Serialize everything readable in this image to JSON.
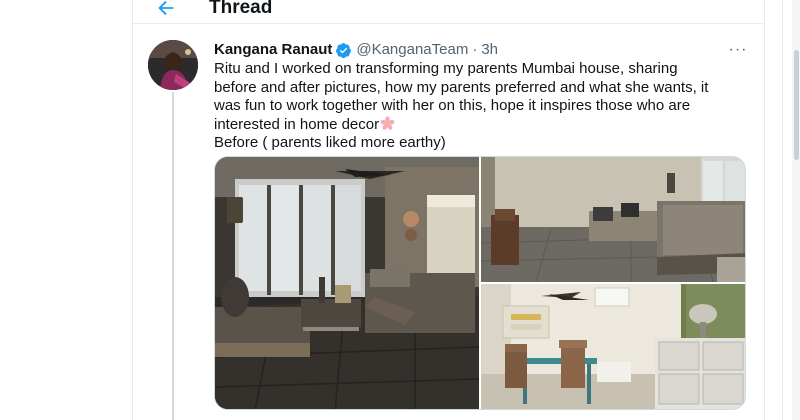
{
  "header": {
    "title": "Thread",
    "back_icon": "arrow-left-icon"
  },
  "tweet": {
    "author_name": "Kangana Ranaut",
    "verified_icon": "verified-badge-icon",
    "handle": "@KanganaTeam",
    "separator": "·",
    "time": "3h",
    "more_icon": "more-horizontal-icon",
    "more_label": "···",
    "text_lines": [
      "Ritu and I worked on transforming my parents Mumbai house, sharing",
      "before and after pictures, how my parents preferred and what she wants, it",
      "was fun to work together with her on this, hope it inspires those who are",
      "interested in home decor",
      "Before ( parents liked more earthy)"
    ],
    "emoji_icon": "blossom-emoji-icon"
  },
  "media": {
    "photos": [
      {
        "name": "photo-living-room",
        "icon": "photo-living-room-icon"
      },
      {
        "name": "photo-lounge",
        "icon": "photo-lounge-icon"
      },
      {
        "name": "photo-dining",
        "icon": "photo-dining-icon"
      }
    ]
  },
  "colors": {
    "accent": "#1d9bf0",
    "text_primary": "#0f1419",
    "text_secondary": "#536471",
    "border": "#e6ecf0",
    "thread_line": "#cfd9de"
  }
}
